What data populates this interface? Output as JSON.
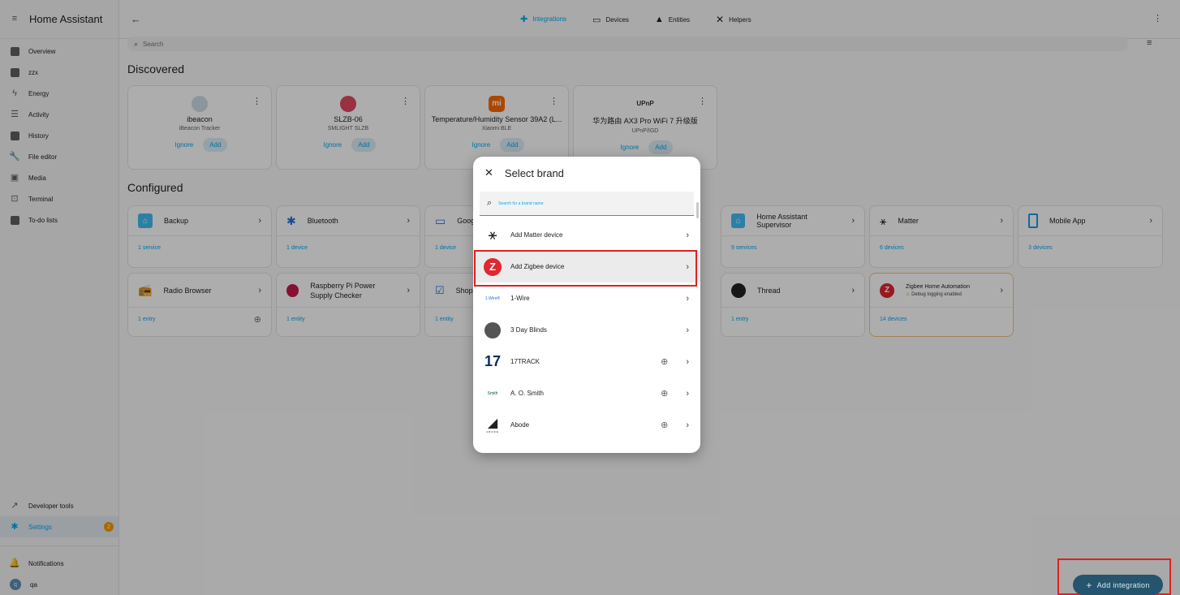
{
  "app_title": "Home Assistant",
  "sidebar": {
    "items": [
      {
        "label": "Overview",
        "icon": "dashboard-icon"
      },
      {
        "label": "zzx",
        "icon": "dashboard-icon"
      },
      {
        "label": "Energy",
        "icon": "lightning-icon"
      },
      {
        "label": "Activity",
        "icon": "list-icon"
      },
      {
        "label": "History",
        "icon": "chart-box-icon"
      },
      {
        "label": "File editor",
        "icon": "wrench-icon"
      },
      {
        "label": "Media",
        "icon": "media-icon"
      },
      {
        "label": "Terminal",
        "icon": "console-icon"
      },
      {
        "label": "To-do lists",
        "icon": "clipboard-icon"
      }
    ],
    "bottom_items": [
      {
        "label": "Developer tools",
        "icon": "hammer-icon"
      },
      {
        "label": "Settings",
        "icon": "cog-icon",
        "badge": "2"
      },
      {
        "label": "Notifications",
        "icon": "bell-icon"
      },
      {
        "label": "qa",
        "avatar": "q"
      }
    ]
  },
  "header": {
    "tabs": [
      {
        "label": "Integrations",
        "icon": "puzzle-icon",
        "active": true
      },
      {
        "label": "Devices",
        "icon": "devices-icon"
      },
      {
        "label": "Entities",
        "icon": "shapes-icon"
      },
      {
        "label": "Helpers",
        "icon": "tools-icon"
      }
    ]
  },
  "search": {
    "placeholder": "Search"
  },
  "discovered": {
    "title": "Discovered",
    "cards": [
      {
        "name": "ibeacon",
        "sub": "iBeacon Tracker",
        "ignore": "Ignore",
        "add": "Add",
        "color": "#9fb6c7"
      },
      {
        "name": "SLZB-06",
        "sub": "SMLIGHT SLZB",
        "ignore": "Ignore",
        "add": "Add",
        "color": "#e04a5f"
      },
      {
        "name": "Temperature/Humidity Sensor 39A2 (L...",
        "sub": "Xiaomi BLE",
        "ignore": "Ignore",
        "add": "Add",
        "color": "#ff6900",
        "logo_text": "mi"
      },
      {
        "name": "华为路由 AX3 Pro WiFi 7 升级版",
        "sub": "UPnP/IGD",
        "ignore": "Ignore",
        "add": "Add",
        "logo_text": "UPnP"
      }
    ]
  },
  "configured": {
    "title": "Configured",
    "cards": [
      {
        "name": "Backup",
        "status": "1 service"
      },
      {
        "name": "Bluetooth",
        "status": "1 device"
      },
      {
        "name": "Goog",
        "status": "1 device"
      },
      {
        "name": "Home Assistant Supervisor",
        "status": "9 services"
      },
      {
        "name": "Matter",
        "status": "6 devices"
      },
      {
        "name": "Mobile App",
        "status": "3 devices"
      },
      {
        "name": "Radio Browser",
        "status": "1 entry"
      },
      {
        "name": "Raspberry Pi Power Supply Checker",
        "status": "1 entity"
      },
      {
        "name": "Shop",
        "status": "1 entity"
      },
      {
        "name": "Thread",
        "status": "1 entry"
      },
      {
        "name": "Zigbee Home Automation",
        "sub": "Debug logging enabled",
        "status": "14 devices"
      }
    ]
  },
  "dialog": {
    "title": "Select brand",
    "search_placeholder": "Search for a brand name",
    "brands": [
      {
        "name": "Add Matter device"
      },
      {
        "name": "Add Zigbee device",
        "selected": true
      },
      {
        "name": "1-Wire",
        "logo_text": "1-Wire®"
      },
      {
        "name": "3 Day Blinds"
      },
      {
        "name": "17TRACK",
        "cloud": true,
        "logo_text": "17"
      },
      {
        "name": "A. O. Smith",
        "cloud": true,
        "logo_text": "Smith"
      },
      {
        "name": "Abode",
        "cloud": true,
        "logo_text": "ABODE"
      }
    ]
  },
  "fab": {
    "label": "Add integration"
  },
  "colors": {
    "accent": "#03a9f4",
    "highlight": "#e02020",
    "fab": "#24546e"
  }
}
